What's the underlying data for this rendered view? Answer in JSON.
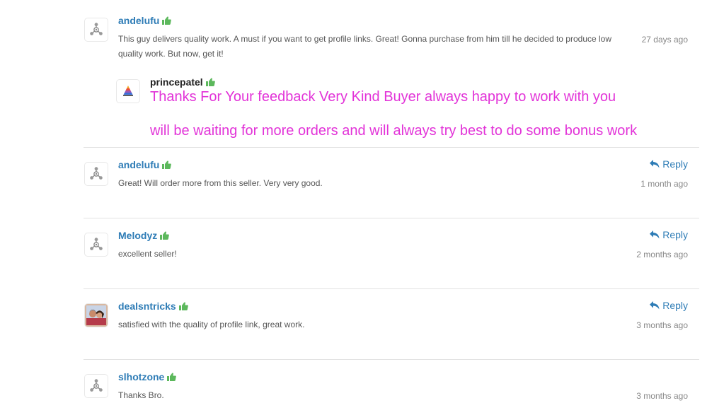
{
  "reviews": [
    {
      "username": "andelufu",
      "comment": "This guy delivers quality work. A must if you want to get profile links. Great! Gonna purchase from him till he decided to produce low quality work. But now, get it!",
      "time": "27 days ago",
      "seller_reply": {
        "username": "princepatel",
        "line1": "Thanks For Your feedback Very Kind Buyer always happy to work with you",
        "line2": "will be waiting for more orders and will always try best to do some bonus work"
      }
    },
    {
      "username": "andelufu",
      "comment": "Great! Will order more from this seller. Very very good.",
      "time": "1 month ago",
      "reply_label": "Reply"
    },
    {
      "username": "Melodyz",
      "comment": "excellent seller!",
      "time": "2 months ago",
      "reply_label": "Reply"
    },
    {
      "username": "dealsntricks",
      "comment": "satisfied with the quality of profile link, great work.",
      "time": "3 months ago",
      "reply_label": "Reply"
    },
    {
      "username": "slhotzone",
      "comment": "Thanks Bro.",
      "time": "3 months ago"
    }
  ],
  "icons": {
    "thumb": "thumbs-up-icon",
    "reply": "reply-arrow-icon",
    "default_avatar": "molecule-avatar-icon"
  },
  "colors": {
    "username": "#2e7cb6",
    "thumb": "#5cb85c",
    "seller_reply_text": "#e233d8",
    "time": "#888888"
  }
}
